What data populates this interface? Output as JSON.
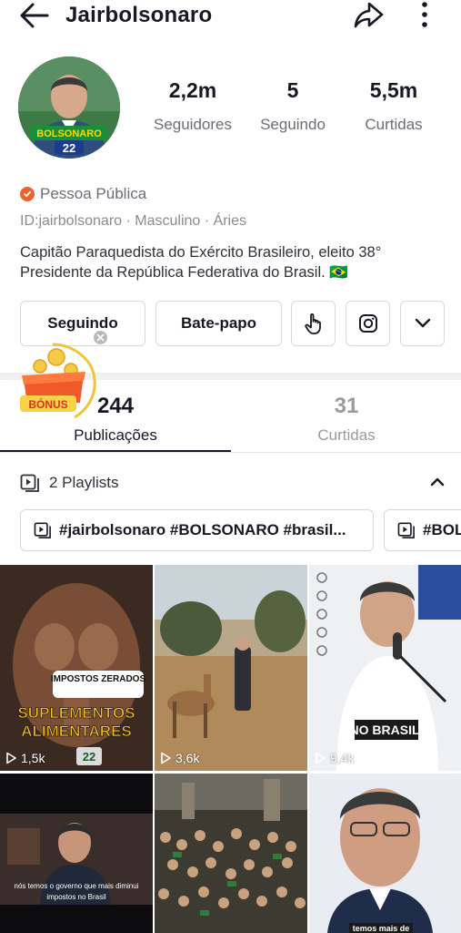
{
  "header": {
    "username": "Jairbolsonaro",
    "icons": [
      "back-arrow-icon",
      "share-icon",
      "more-vertical-icon"
    ]
  },
  "avatar": {
    "badge_text": "BOLSONARO",
    "badge_number": "22"
  },
  "stats": [
    {
      "value": "2,2m",
      "label": "Seguidores"
    },
    {
      "value": "5",
      "label": "Seguindo"
    },
    {
      "value": "5,5m",
      "label": "Curtidas"
    }
  ],
  "profile": {
    "role": "Pessoa Pública",
    "meta": "ID:jairbolsonaro · Masculino · Áries",
    "bio_line1": "Capitão Paraquedista do Exército Brasileiro, eleito 38°",
    "bio_line2": "Presidente da República Federativa do Brasil. 🇧🇷"
  },
  "buttons": {
    "following": "Seguindo",
    "chat": "Bate-papo"
  },
  "bonus": {
    "label": "BÓNUS"
  },
  "tabs": [
    {
      "count": "244",
      "label": "Publicações"
    },
    {
      "count": "31",
      "label": "Curtidas"
    }
  ],
  "playlists": {
    "header": "2 Playlists",
    "items": [
      "#jairbolsonaro #BOLSONARO #brasil...",
      "#BOLSONARO"
    ]
  },
  "videos": [
    {
      "views": "1,5k",
      "caption1": "IMPOSTOS ZERADOS",
      "caption2": "SUPLEMENTOS",
      "caption3": "ALIMENTARES",
      "tag": "22"
    },
    {
      "views": "3,6k"
    },
    {
      "views": "9,4k",
      "caption1": "NO BRASIL."
    },
    {
      "views": "",
      "caption1": "nós temos o governo que mais diminui",
      "caption2": "impostos no Brasil"
    },
    {
      "views": ""
    },
    {
      "views": "",
      "caption1": "temos mais de"
    }
  ],
  "colors": {
    "accent": "#f1612b",
    "text": "#161823",
    "muted": "#6b6e76"
  }
}
